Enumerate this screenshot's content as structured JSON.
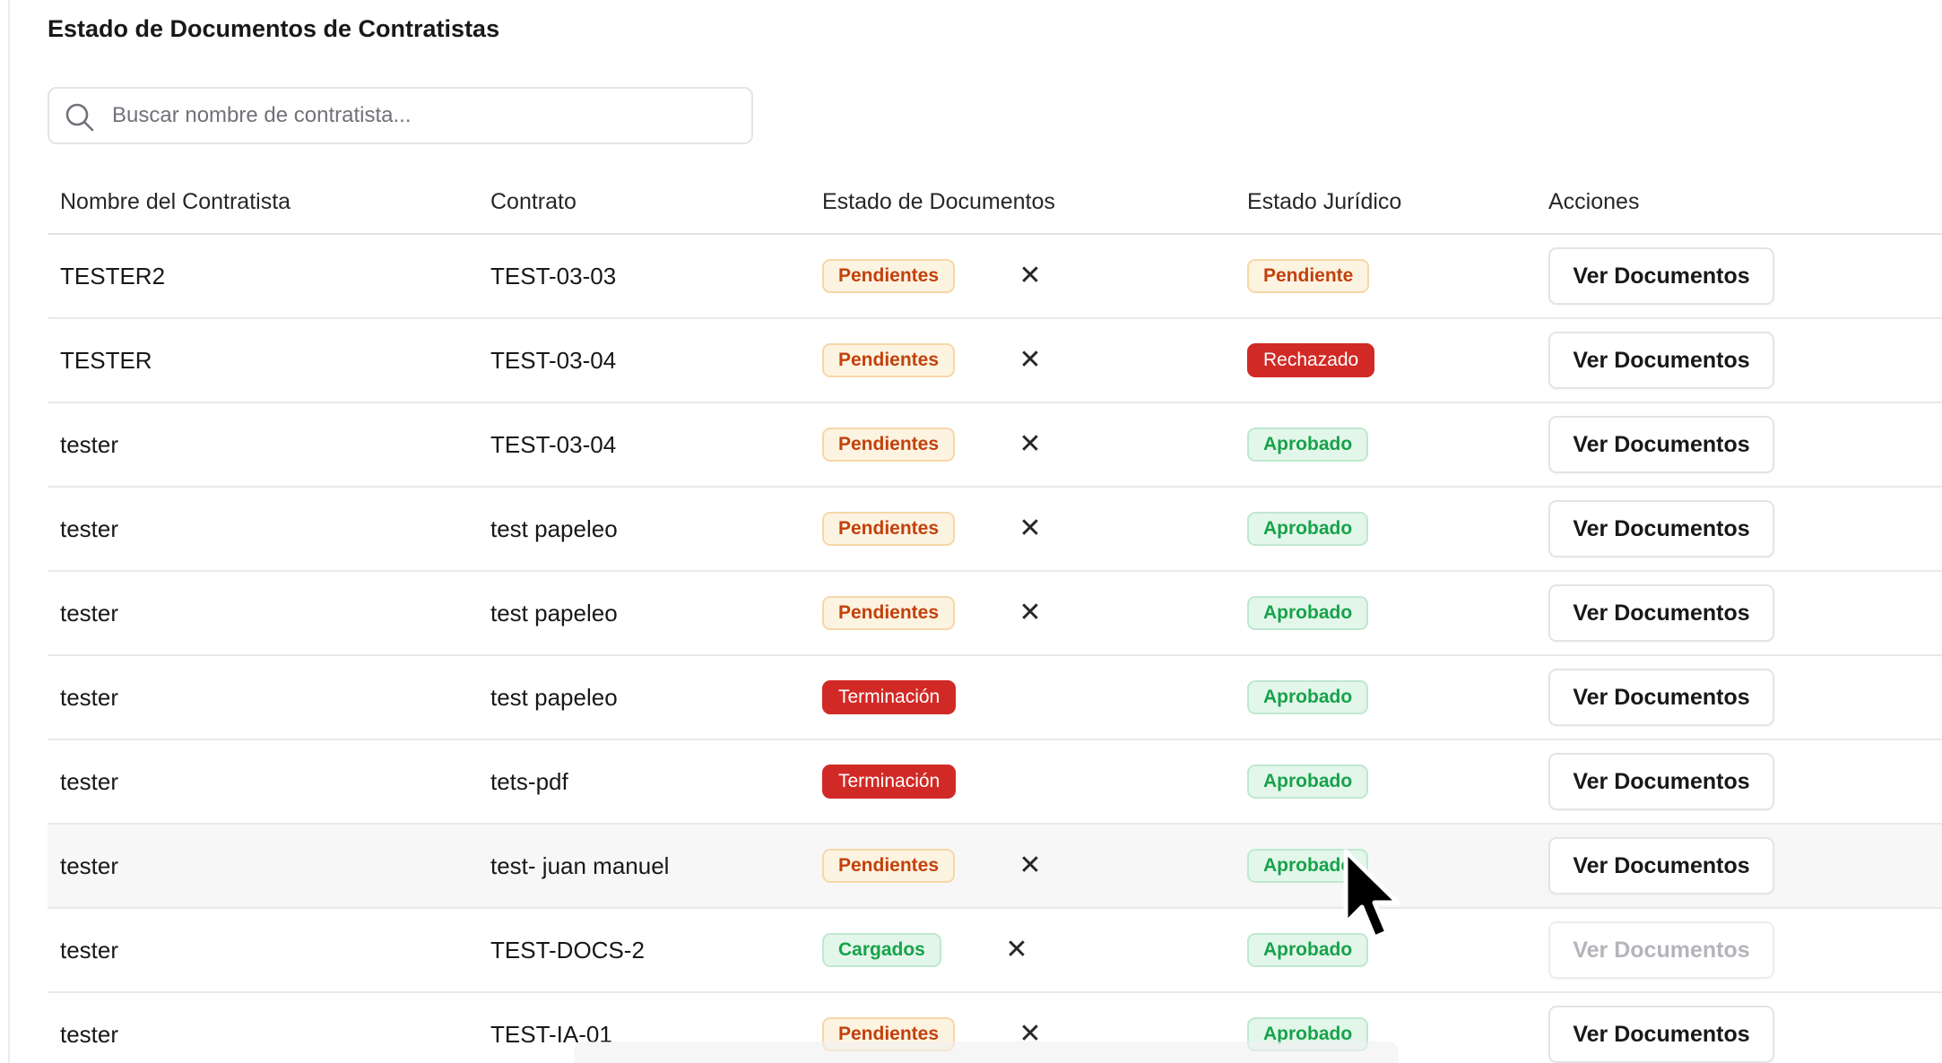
{
  "page": {
    "title": "Estado de Documentos de Contratistas"
  },
  "search": {
    "placeholder": "Buscar nombre de contratista...",
    "value": "",
    "icon": "search-icon"
  },
  "table": {
    "headers": {
      "contractor": "Nombre del Contratista",
      "contract": "Contrato",
      "doc_status": "Estado de Documentos",
      "legal_status": "Estado Jurídico",
      "actions": "Acciones"
    },
    "rows": [
      {
        "contractor": "TESTER2",
        "contract": "TEST-03-03",
        "doc_status": "Pendientes",
        "doc_status_type": "pending",
        "has_x": true,
        "legal_status": "Pendiente",
        "legal_status_type": "pending",
        "action": "Ver Documentos",
        "action_disabled": false
      },
      {
        "contractor": "TESTER",
        "contract": "TEST-03-04",
        "doc_status": "Pendientes",
        "doc_status_type": "pending",
        "has_x": true,
        "legal_status": "Rechazado",
        "legal_status_type": "danger",
        "action": "Ver Documentos",
        "action_disabled": false
      },
      {
        "contractor": "tester",
        "contract": "TEST-03-04",
        "doc_status": "Pendientes",
        "doc_status_type": "pending",
        "has_x": true,
        "legal_status": "Aprobado",
        "legal_status_type": "success",
        "action": "Ver Documentos",
        "action_disabled": false
      },
      {
        "contractor": "tester",
        "contract": "test papeleo",
        "doc_status": "Pendientes",
        "doc_status_type": "pending",
        "has_x": true,
        "legal_status": "Aprobado",
        "legal_status_type": "success",
        "action": "Ver Documentos",
        "action_disabled": false
      },
      {
        "contractor": "tester",
        "contract": "test papeleo",
        "doc_status": "Pendientes",
        "doc_status_type": "pending",
        "has_x": true,
        "legal_status": "Aprobado",
        "legal_status_type": "success",
        "action": "Ver Documentos",
        "action_disabled": false
      },
      {
        "contractor": "tester",
        "contract": "test papeleo",
        "doc_status": "Terminación",
        "doc_status_type": "danger",
        "has_x": false,
        "legal_status": "Aprobado",
        "legal_status_type": "success",
        "action": "Ver Documentos",
        "action_disabled": false
      },
      {
        "contractor": "tester",
        "contract": "tets-pdf",
        "doc_status": "Terminación",
        "doc_status_type": "danger",
        "has_x": false,
        "legal_status": "Aprobado",
        "legal_status_type": "success",
        "action": "Ver Documentos",
        "action_disabled": false
      },
      {
        "contractor": "tester",
        "contract": "test- juan manuel",
        "doc_status": "Pendientes",
        "doc_status_type": "pending",
        "has_x": true,
        "legal_status": "Aprobado",
        "legal_status_type": "success",
        "action": "Ver Documentos",
        "action_disabled": false,
        "hovered": true
      },
      {
        "contractor": "tester",
        "contract": "TEST-DOCS-2",
        "doc_status": "Cargados",
        "doc_status_type": "success",
        "has_x": true,
        "legal_status": "Aprobado",
        "legal_status_type": "success",
        "action": "Ver Documentos",
        "action_disabled": true
      },
      {
        "contractor": "tester",
        "contract": "TEST-IA-01",
        "doc_status": "Pendientes",
        "doc_status_type": "pending",
        "has_x": true,
        "legal_status": "Aprobado",
        "legal_status_type": "success",
        "action": "Ver Documentos",
        "action_disabled": false
      }
    ],
    "remove_glyph": "✕"
  },
  "colors": {
    "pending_bg": "#fdf3e1",
    "pending_text": "#c2410c",
    "danger_bg": "#d12a26",
    "success_bg": "#e3f6ea",
    "success_text": "#16a34a"
  }
}
